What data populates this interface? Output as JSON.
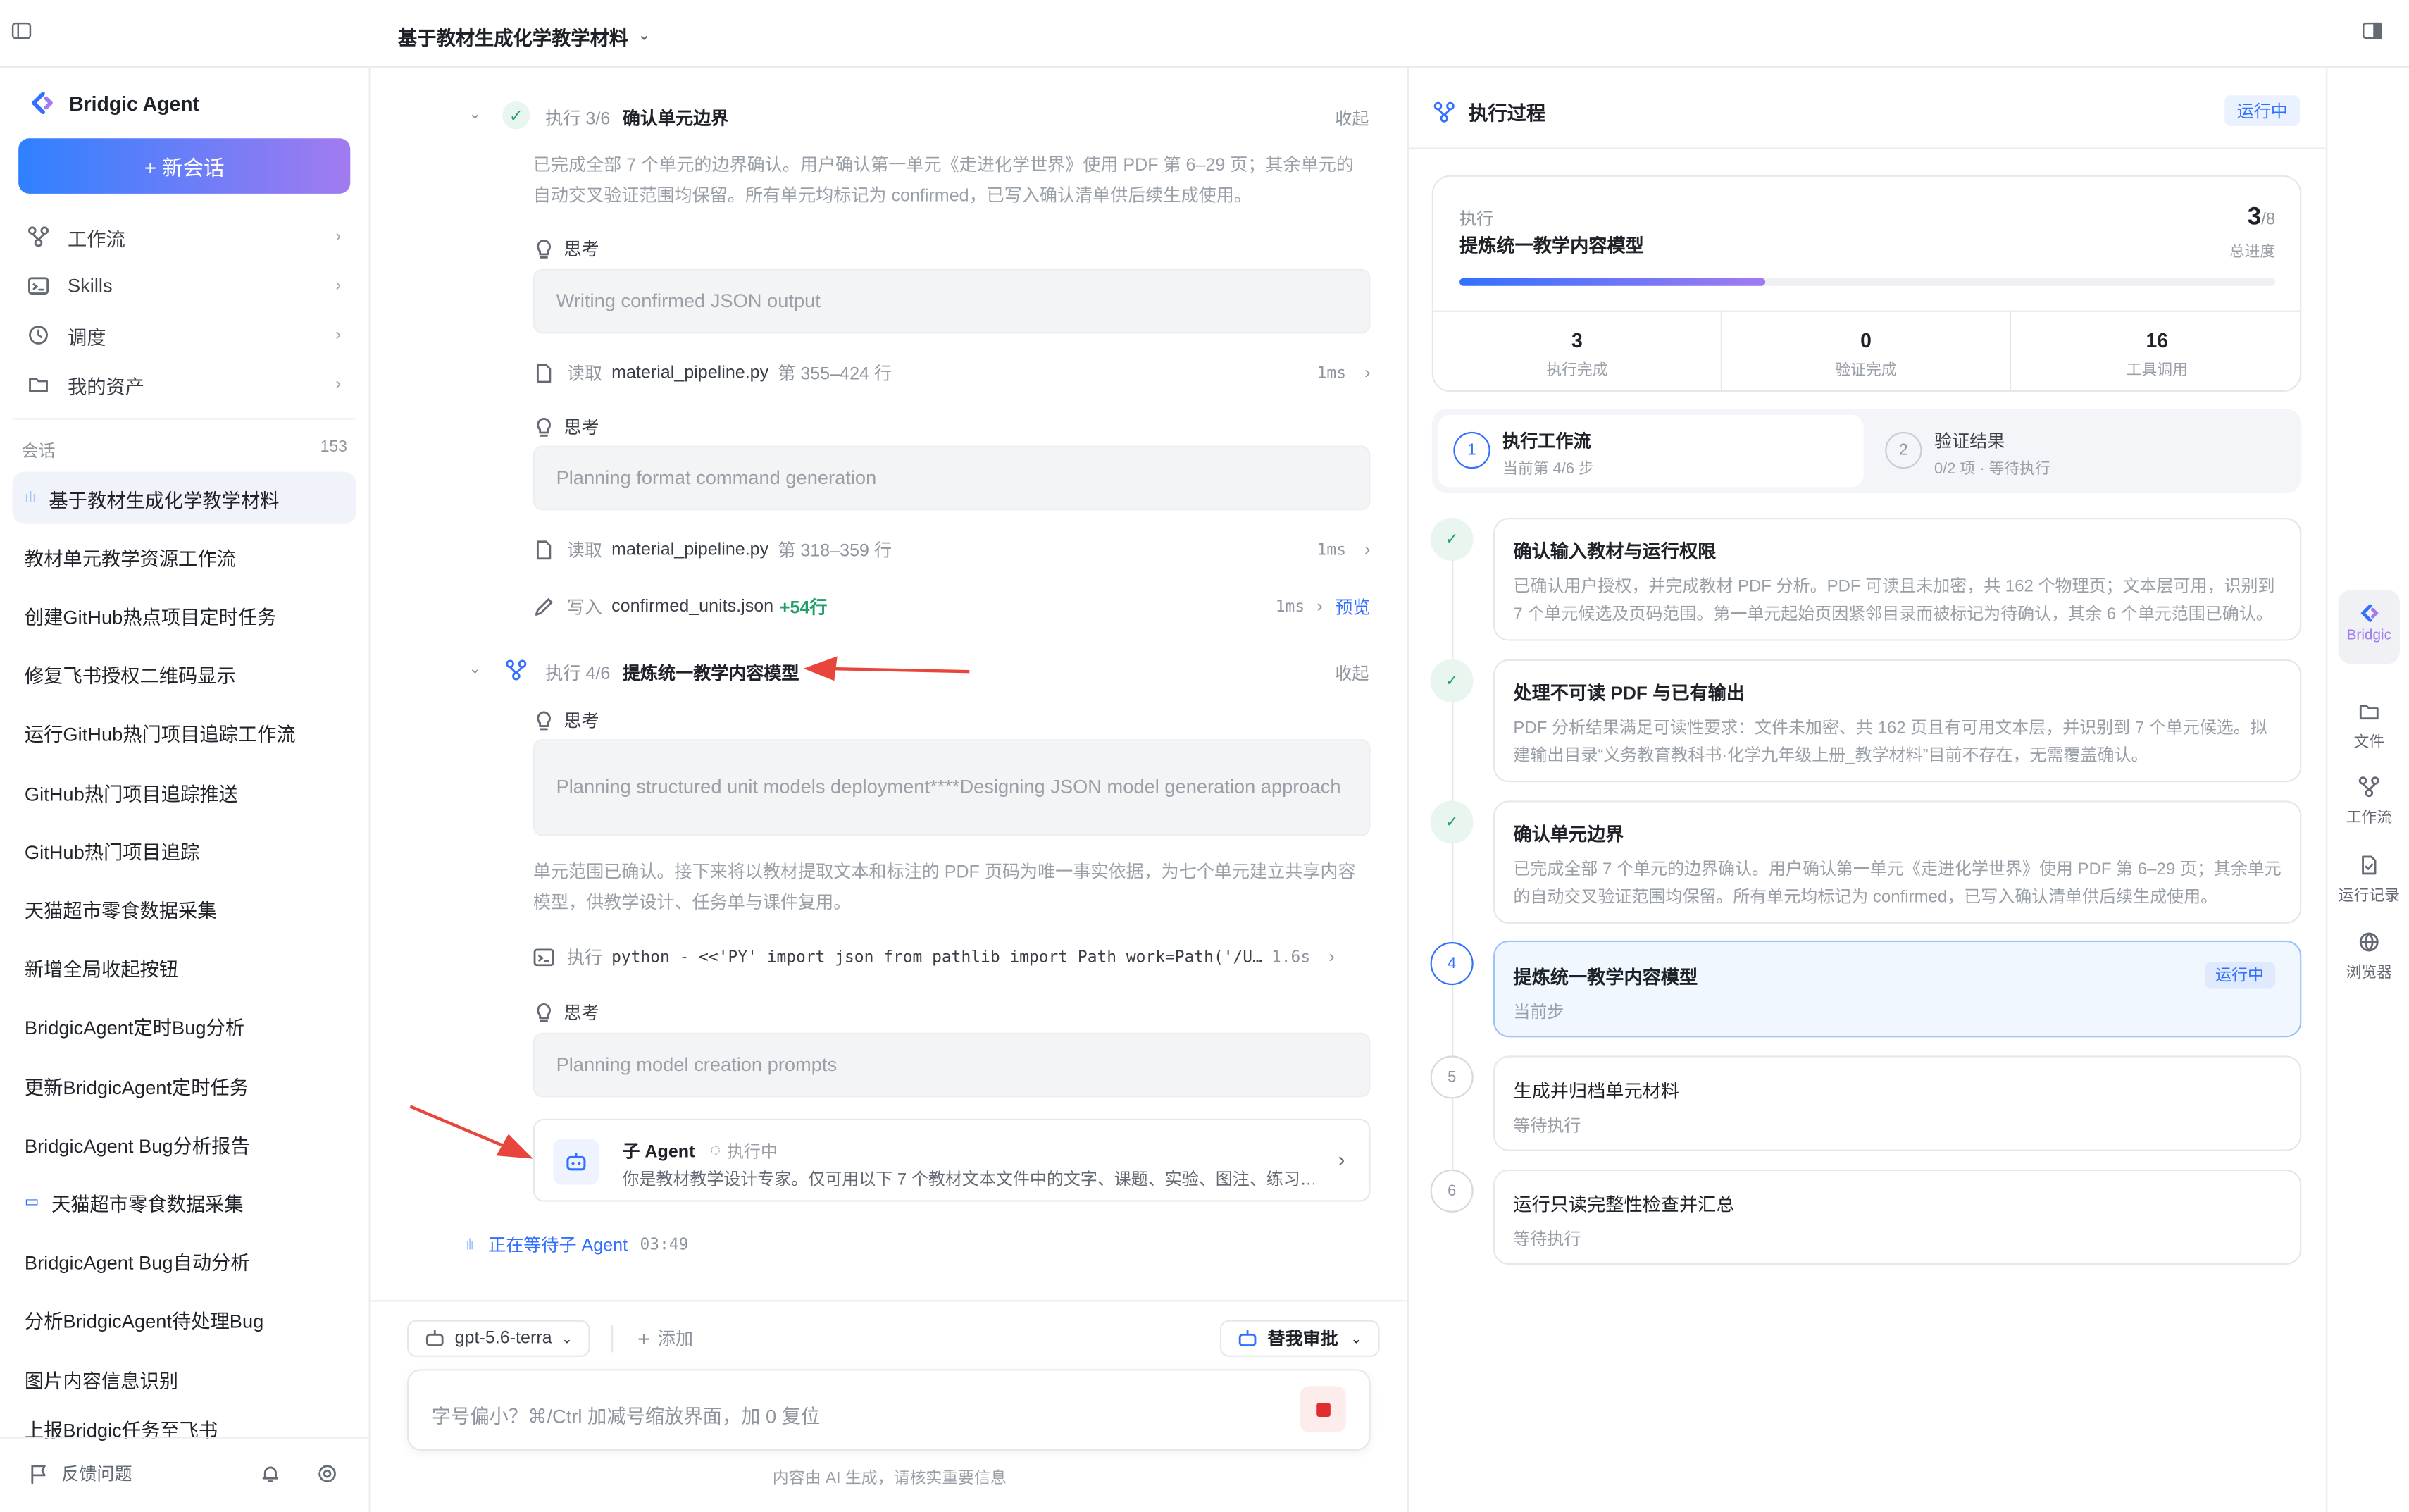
{
  "topbar": {
    "title": "基于教材生成化学教学材料"
  },
  "sidebar": {
    "brand": "Bridgic Agent",
    "new_chat": "+ 新会话",
    "nav": [
      {
        "label": "工作流",
        "icon": "workflow-icon"
      },
      {
        "label": "Skills",
        "icon": "terminal-icon"
      },
      {
        "label": "调度",
        "icon": "clock-icon"
      },
      {
        "label": "我的资产",
        "icon": "folder-icon"
      }
    ],
    "section_label": "会话",
    "section_count": "153",
    "conversations": [
      "基于教材生成化学教学材料",
      "教材单元教学资源工作流",
      "创建GitHub热点项目定时任务",
      "修复飞书授权二维码显示",
      "运行GitHub热门项目追踪工作流",
      "GitHub热门项目追踪推送",
      "GitHub热门项目追踪",
      "天猫超市零食数据采集",
      "新增全局收起按钮",
      "BridgicAgent定时Bug分析",
      "更新BridgicAgent定时任务",
      "BridgicAgent Bug分析报告",
      "天猫超市零食数据采集",
      "BridgicAgent Bug自动分析",
      "分析BridgicAgent待处理Bug",
      "图片内容信息识别",
      "上报Bridgic任务至飞书"
    ],
    "feedback": "反馈问题"
  },
  "center": {
    "step3": {
      "label": "执行 3/6",
      "title": "确认单元边界",
      "collapse": "收起",
      "desc": "已完成全部 7 个单元的边界确认。用户确认第一单元《走进化学世界》使用 PDF 第 6–29 页；其余单元的自动交叉验证范围均保留。所有单元均标记为 confirmed，已写入确认清单供后续生成使用。"
    },
    "think_label": "思考",
    "think1": "Writing confirmed JSON output",
    "read1": {
      "verb": "读取",
      "file": "material_pipeline.py",
      "range": "第 355–424 行",
      "dur": "1ms"
    },
    "think2": "Planning format command generation",
    "read2": {
      "verb": "读取",
      "file": "material_pipeline.py",
      "range": "第 318–359 行",
      "dur": "1ms"
    },
    "write1": {
      "verb": "写入",
      "file": "confirmed_units.json",
      "delta": "+54行",
      "dur": "1ms",
      "preview": "预览"
    },
    "step4": {
      "label": "执行 4/6",
      "title": "提炼统一教学内容模型",
      "collapse": "收起"
    },
    "think3": "Planning structured unit models deployment****Designing JSON model generation approach",
    "para": "单元范围已确认。接下来将以教材提取文本和标注的 PDF 页码为唯一事实依据，为七个单元建立共享内容模型，供教学设计、任务单与课件复用。",
    "exec": {
      "verb": "执行",
      "cmd": "python - <<'PY' import json from pathlib import Path work=Path('/U…",
      "dur": "1.6s"
    },
    "think4": "Planning model creation prompts",
    "subagent": {
      "title": "子 Agent",
      "status": "执行中",
      "desc": "你是教材教学设计专家。仅可用以下 7 个教材文本文件中的文字、课题、实验、图注、练习…"
    },
    "waiting": {
      "text": "正在等待子 Agent",
      "time": "03:49"
    },
    "model": "gpt-5.6-terra",
    "add": "添加",
    "approve": "替我审批",
    "input_placeholder": "字号偏小？⌘/Ctrl 加减号缩放界面，加 0 复位",
    "disclaimer": "内容由 AI 生成，请核实重要信息"
  },
  "right": {
    "header": "执行过程",
    "status": "运行中",
    "progress": {
      "label": "执行",
      "title": "提炼统一教学内容模型",
      "current": "3",
      "total": "/8",
      "caption": "总进度",
      "fraction": 0.375
    },
    "stats": [
      {
        "n": "3",
        "t": "执行完成"
      },
      {
        "n": "0",
        "t": "验证完成"
      },
      {
        "n": "16",
        "t": "工具调用"
      }
    ],
    "tabs": [
      {
        "num": "1",
        "title": "执行工作流",
        "sub": "当前第 4/6 步"
      },
      {
        "num": "2",
        "title": "验证结果",
        "sub": "0/2 项 · 等待执行"
      }
    ],
    "steps": [
      {
        "state": "done",
        "title": "确认输入教材与运行权限",
        "desc": "已确认用户授权，并完成教材 PDF 分析。PDF 可读且未加密，共 162 个物理页；文本层可用，识别到 7 个单元候选及页码范围。第一单元起始页因紧邻目录而被标记为待确认，其余 6 个单元范围已确认。"
      },
      {
        "state": "done",
        "title": "处理不可读 PDF 与已有输出",
        "desc": "PDF 分析结果满足可读性要求：文件未加密、共 162 页且有可用文本层，并识别到 7 个单元候选。拟建输出目录“义务教育教科书·化学九年级上册_教学材料”目前不存在，无需覆盖确认。"
      },
      {
        "state": "done",
        "title": "确认单元边界",
        "desc": "已完成全部 7 个单元的边界确认。用户确认第一单元《走进化学世界》使用 PDF 第 6–29 页；其余单元的自动交叉验证范围均保留。所有单元均标记为 confirmed，已写入确认清单供后续生成使用。"
      },
      {
        "state": "active",
        "num": "4",
        "title": "提炼统一教学内容模型",
        "badge": "运行中",
        "desc": "当前步"
      },
      {
        "state": "pending",
        "num": "5",
        "title": "生成并归档单元材料",
        "desc": "等待执行"
      },
      {
        "state": "pending",
        "num": "6",
        "title": "运行只读完整性检查并汇总",
        "desc": "等待执行"
      }
    ]
  },
  "rail": {
    "items": [
      {
        "label": "Bridgic",
        "icon": "bridgic-logo-icon"
      },
      {
        "label": "文件",
        "icon": "folder-icon"
      },
      {
        "label": "工作流",
        "icon": "workflow-icon"
      },
      {
        "label": "运行记录",
        "icon": "record-icon"
      },
      {
        "label": "浏览器",
        "icon": "globe-icon"
      }
    ]
  },
  "colors": {
    "accent": "#3370ff",
    "brand_gradient": [
      "#2f80ff",
      "#a27bf0"
    ],
    "success": "#22a06b",
    "annotation": "#e8453c"
  }
}
